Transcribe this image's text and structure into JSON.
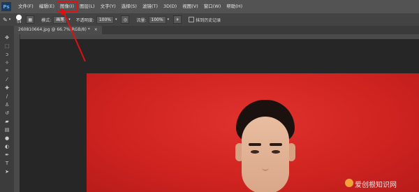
{
  "app": {
    "logo_text": "Ps"
  },
  "menubar": {
    "items": [
      "文件(F)",
      "编辑(E)",
      "图像(I)",
      "图层(L)",
      "文字(Y)",
      "选择(S)",
      "滤镜(T)",
      "3D(D)",
      "视图(V)",
      "窗口(W)",
      "帮助(H)"
    ],
    "highlighted_item": "图像(I)",
    "highlight_color": "#dd1111"
  },
  "options": {
    "brush_size": "54",
    "mode_label": "模式:",
    "mode_value": "画笔",
    "opacity_label": "不透明度:",
    "opacity_value": "100%",
    "flow_label": "流量:",
    "flow_value": "100%",
    "history_label": "抹到历史记录"
  },
  "document_tab": {
    "title": "260810664.jpg @ 66.7%(RGB/8) *"
  },
  "toolbar": {
    "tools": [
      "move-tool",
      "marquee-tool",
      "lasso-tool",
      "quick-select-tool",
      "crop-tool",
      "eyedropper-tool",
      "healing-tool",
      "brush-tool",
      "stamp-tool",
      "history-brush-tool",
      "eraser-tool",
      "gradient-tool",
      "blur-tool",
      "dodge-tool",
      "pen-tool",
      "type-tool",
      "path-select-tool"
    ]
  },
  "photo": {
    "background_color": "#d42a27"
  },
  "watermark": {
    "text": "爱创根知识网"
  }
}
